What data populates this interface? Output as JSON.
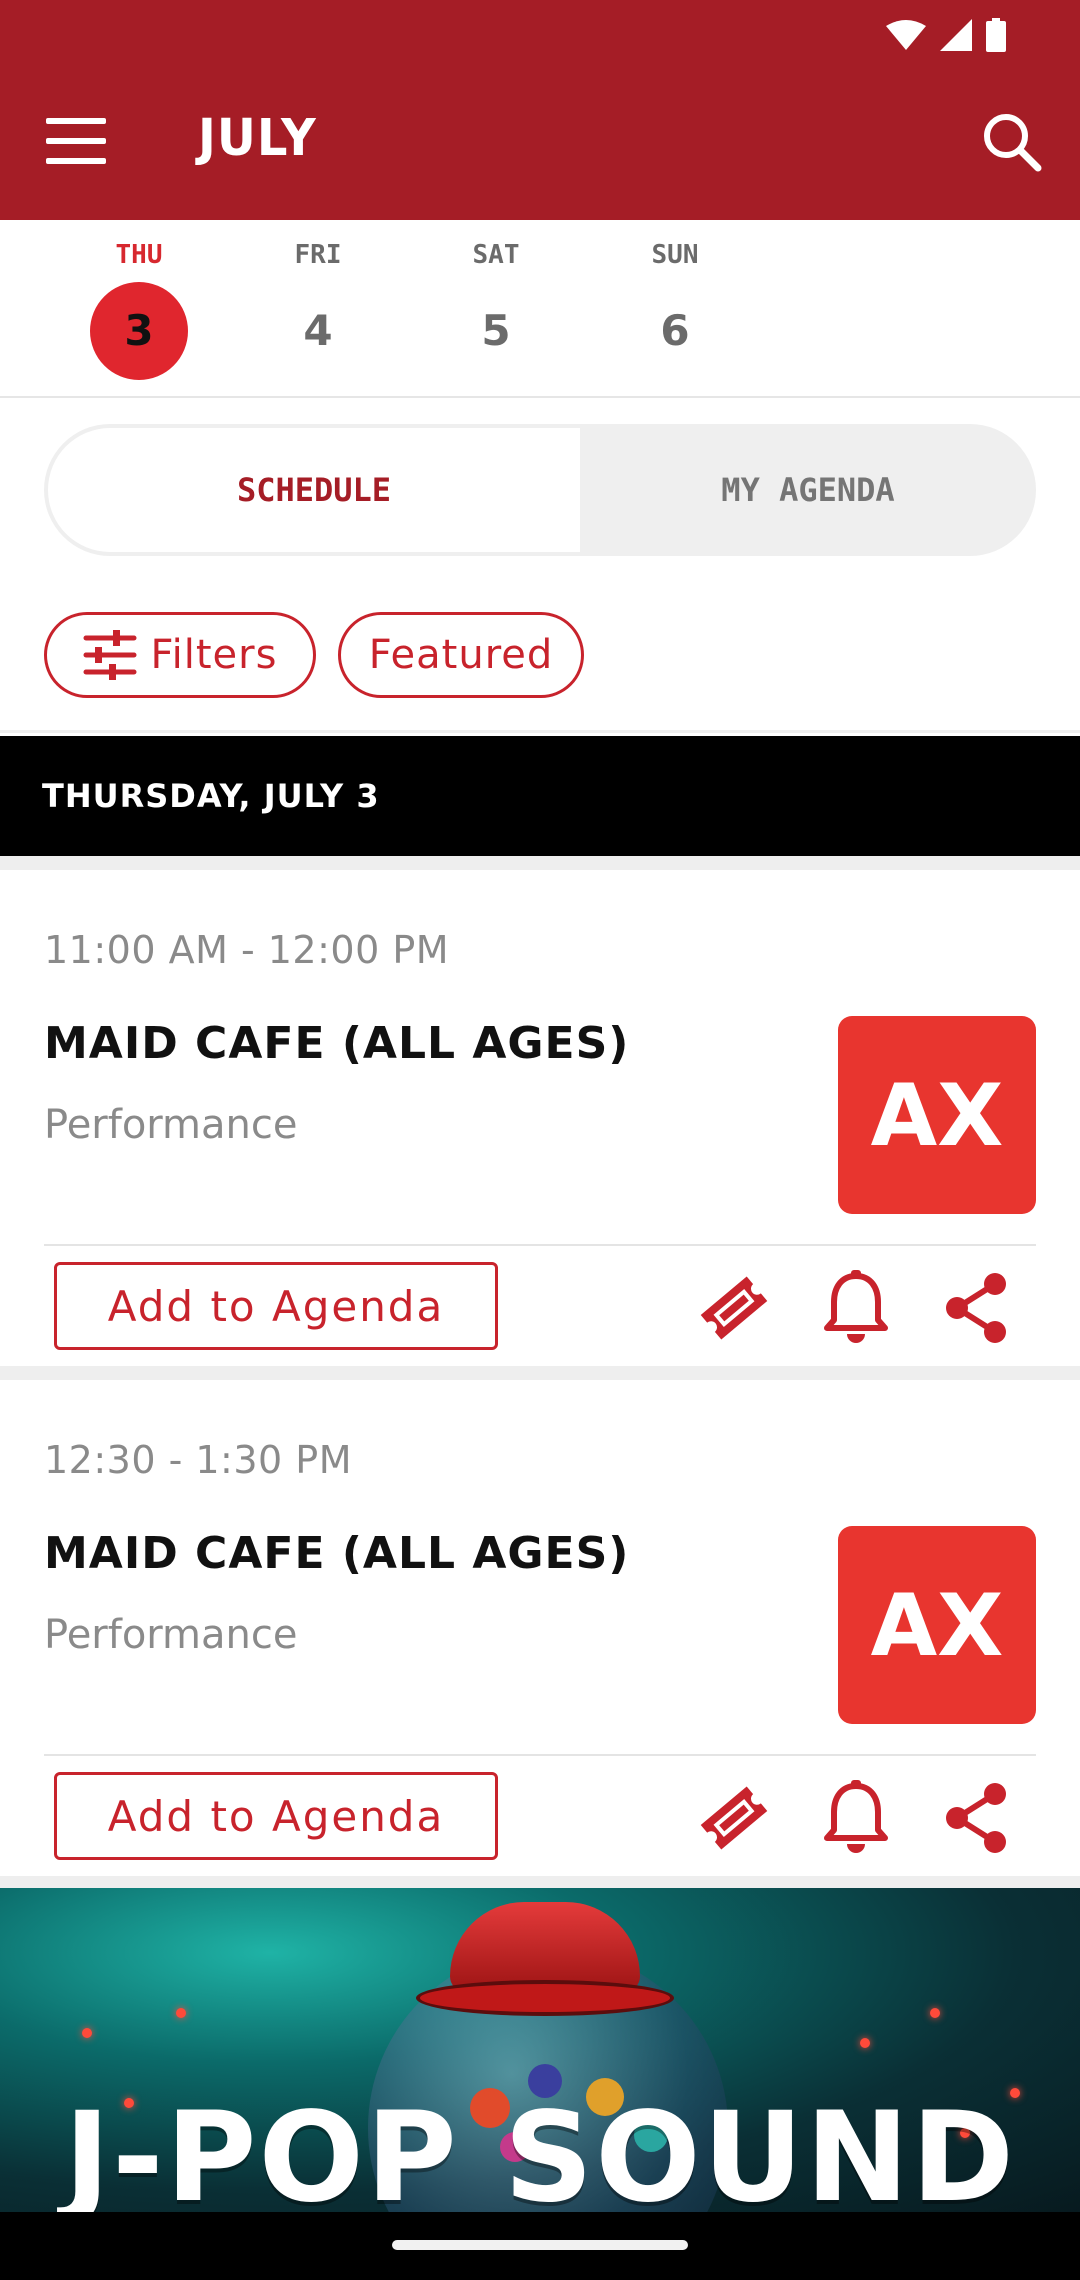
{
  "header": {
    "title": "JULY",
    "background": "#a51d26"
  },
  "days": [
    {
      "dow": "THU",
      "num": "3",
      "active": true
    },
    {
      "dow": "FRI",
      "num": "4",
      "active": false
    },
    {
      "dow": "SAT",
      "num": "5",
      "active": false
    },
    {
      "dow": "SUN",
      "num": "6",
      "active": false
    }
  ],
  "segmented": {
    "schedule": "SCHEDULE",
    "my_agenda": "MY AGENDA",
    "selected": "SCHEDULE"
  },
  "chips": {
    "filters": "Filters",
    "featured": "Featured"
  },
  "section": {
    "header": "THURSDAY, JULY 3"
  },
  "events": [
    {
      "time": "11:00 AM - 12:00 PM",
      "title": "MAID CAFE (ALL AGES)",
      "category": "Performance",
      "logo_text": "AX",
      "add_label": "Add to Agenda"
    },
    {
      "time": "12:30 - 1:30 PM",
      "title": "MAID CAFE (ALL AGES)",
      "category": "Performance",
      "logo_text": "AX",
      "add_label": "Add to Agenda"
    }
  ],
  "banner": {
    "wordmark": "J-POP SOUND"
  },
  "colors": {
    "accent": "#c8232c",
    "brand_red": "#a51d26",
    "logo_bg": "#e8352f"
  },
  "icons": [
    "wifi-icon",
    "signal-icon",
    "battery-icon",
    "menu-icon",
    "search-icon",
    "tune-icon",
    "ticket-icon",
    "bell-icon",
    "share-icon"
  ]
}
